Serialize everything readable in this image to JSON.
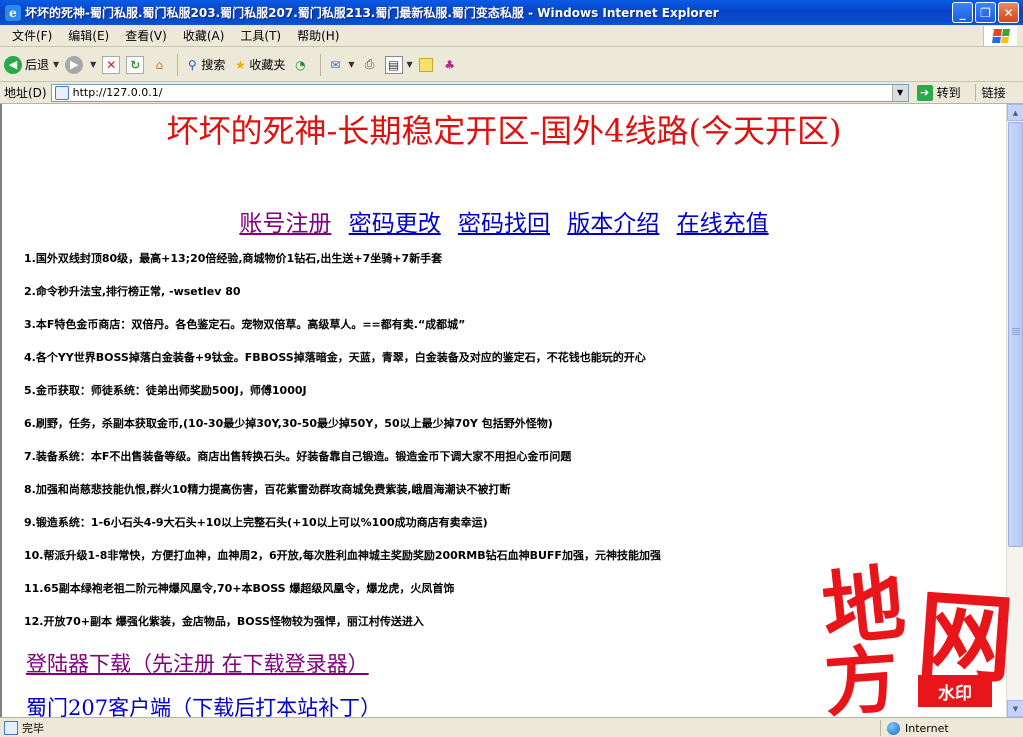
{
  "window": {
    "title": "坏坏的死神-蜀门私服.蜀门私服203.蜀门私服207.蜀门私服213.蜀门最新私服.蜀门变态私服 - Windows Internet Explorer",
    "app_icon": "e",
    "minimize": "_",
    "restore": "❐",
    "close": "✕"
  },
  "menubar": {
    "items": [
      "文件(F)",
      "编辑(E)",
      "查看(V)",
      "收藏(A)",
      "工具(T)",
      "帮助(H)"
    ]
  },
  "toolbar": {
    "back_label": "后退",
    "search_label": "搜索",
    "favorites_label": "收藏夹"
  },
  "addressbar": {
    "label": "地址(D)",
    "url": "http://127.0.0.1/",
    "go_label": "转到",
    "links_label": "链接"
  },
  "page": {
    "headline": "坏坏的死神-长期稳定开区-国外4线路(今天开区)",
    "nav_links": [
      "账号注册",
      "密码更改",
      "密码找回",
      "版本介绍",
      "在线充值"
    ],
    "features": [
      "1.国外双线封顶80级，最高+13;20倍经验,商城物价1钻石,出生送+7坐骑+7新手套",
      "2.命令秒升法宝,排行榜正常, -wsetlev 80",
      "3.本F特色金币商店：双倍丹。各色鉴定石。宠物双倍草。高级草人。==都有卖.“成都城”",
      "4.各个YY世界BOSS掉落白金装备+9钛金。FBBOSS掉落暗金，天蓝，青翠，白金装备及对应的鉴定石，不花钱也能玩的开心",
      "5.金币获取：师徒系统：徒弟出师奖励500J，师傅1000J",
      "6.刷野，任务，杀副本获取金币,(10-30最少掉30Y,30-50最少掉50Y，50以上最少掉70Y 包括野外怪物)",
      "7.装备系统：本F不出售装备等级。商店出售转换石头。好装备靠自己锻造。锻造金币下调大家不用担心金币问题",
      "8.加强和尚慈悲技能仇恨,群火10精力提高伤害，百花紫雷劲群攻商城免费紫装,峨眉海潮诀不被打断",
      "9.锻造系统：1-6小石头4-9大石头+10以上完整石头(+10以上可以%100成功商店有卖幸运)",
      "10.帮派升级1-8非常快，方便打血神，血神周2，6开放,每次胜利血神城主奖励奖励200RMB钻石血神BUFF加强，元神技能加强",
      "11.65副本绿袍老祖二阶元神爆风凰令,70+本BOSS 爆超级风凰令，爆龙虎，火凤首饰",
      "12.开放70+副本 爆强化紫装，金店物品，BOSS怪物较为强悍，丽江村传送进入"
    ],
    "download_links": [
      "登陆器下载（先注册 在下载登录器）",
      "蜀门207客户端（下载后打本站补丁）"
    ]
  },
  "watermark": {
    "chars": [
      "地",
      "方",
      "网"
    ],
    "tag": "水印"
  },
  "statusbar": {
    "status": "完毕",
    "zone": "Internet"
  },
  "colors": {
    "headline": "#e0100e",
    "visited_link": "#800080",
    "link": "#0000cc",
    "watermark": "#e8151b",
    "titlebar": "#0a5be4"
  }
}
